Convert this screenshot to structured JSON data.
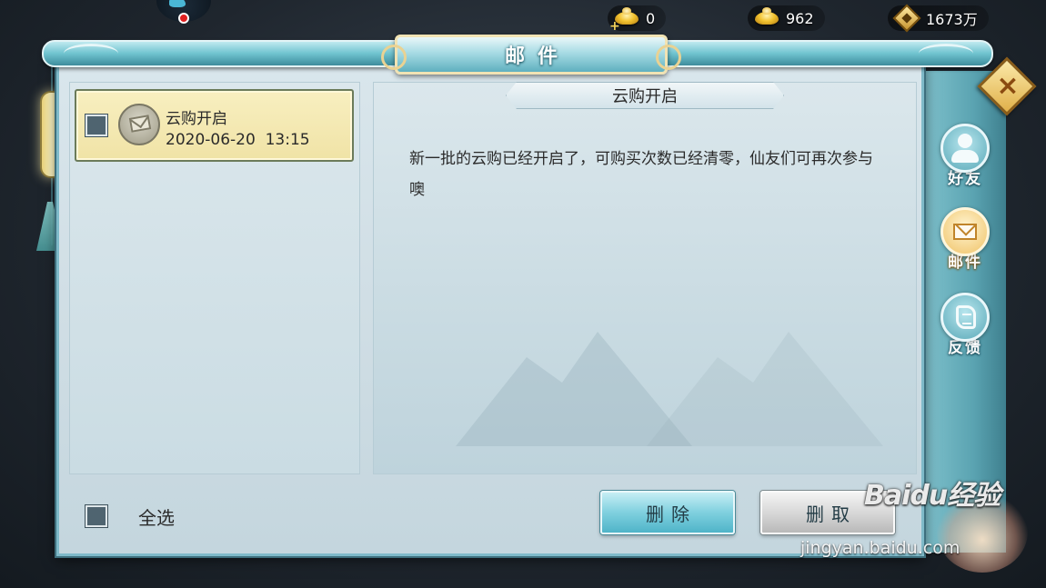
{
  "top_bar": {
    "currency": [
      {
        "name": "gold-ingot",
        "icon": "gold-ingot-icon",
        "value": "0"
      },
      {
        "name": "bound-gold-ingot",
        "icon": "locked-gold-ingot-icon",
        "value": "962"
      },
      {
        "name": "copper-coin",
        "icon": "coin-icon",
        "value": "1673万"
      }
    ]
  },
  "window": {
    "title": "邮件",
    "close_icon": "close-icon"
  },
  "mail_list": {
    "items": [
      {
        "title": "云购开启",
        "date": "2020-06-20  13:15",
        "icon": "envelope-icon",
        "selected": true
      }
    ]
  },
  "mail_detail": {
    "title": "云购开启",
    "body": "新一批的云购已经开启了，可购买次数已经清零，仙友们可再次参与噢"
  },
  "footer": {
    "select_all_label": "全选",
    "delete_label": "删除",
    "collect_label": "删取"
  },
  "side_tabs": [
    {
      "label": "好友",
      "icon": "friend-icon",
      "active": false
    },
    {
      "label": "邮件",
      "icon": "mail-icon",
      "active": true
    },
    {
      "label": "反馈",
      "icon": "feedback-icon",
      "active": false
    }
  ],
  "watermark": {
    "main": "Baidu经验",
    "sub": "jingyan.baidu.com"
  },
  "colors": {
    "panel_bg": "#d9e6ec",
    "selected_item": "#f4e8b2",
    "accent_teal": "#6fc3cf",
    "gold": "#f2c230"
  }
}
